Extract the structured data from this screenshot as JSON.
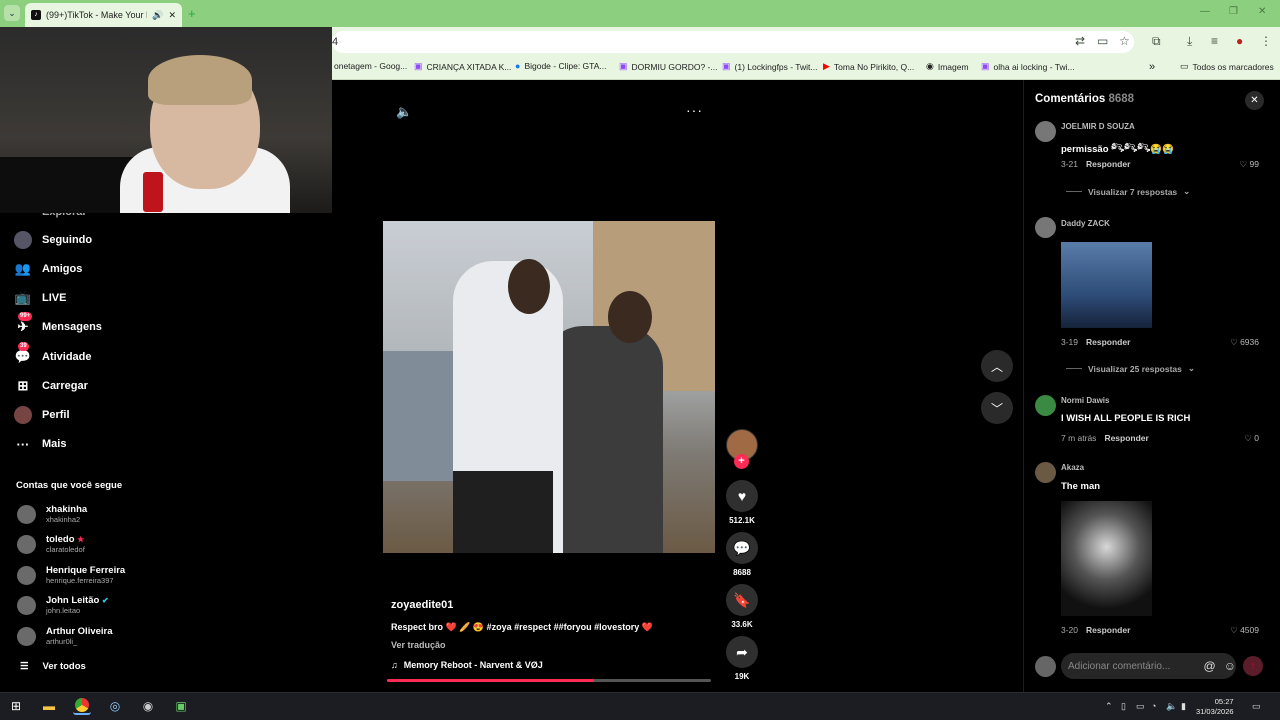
{
  "browser": {
    "tab_title": "(99+)TikTok - Make Your Da",
    "tab_dropdown_icon": "chevron-down-icon",
    "tab_favicon": "tiktok-icon",
    "tab_audio_icon": "speaker-icon",
    "tab_close_icon": "close-icon",
    "new_tab_icon": "plus-icon",
    "address_fragment": "4",
    "bookmarks": [
      {
        "label": "onetagem - Goog...",
        "icon": "twitch-icon"
      },
      {
        "label": "CRIANÇA XITADA K...",
        "icon": "twitch-icon"
      },
      {
        "label": "Bigode - Clipe: GTA...",
        "icon": "facebook-icon"
      },
      {
        "label": "DORMIU GORDO? -...",
        "icon": "twitch-icon"
      },
      {
        "label": "(1) Lockingfps - Twit...",
        "icon": "twitch-icon"
      },
      {
        "label": "Toma No Pirikito, Q...",
        "icon": "youtube-icon"
      },
      {
        "label": "Imagem",
        "icon": "github-icon"
      },
      {
        "label": "olha ai locking - Twi...",
        "icon": "twitch-icon"
      }
    ],
    "bookmarks_overflow": "»",
    "all_bookmarks": "Todos os marcadores"
  },
  "sidebar": {
    "partial_item": "Explorar",
    "items": [
      {
        "label": "Seguindo",
        "icon": "following-icon",
        "badge": ""
      },
      {
        "label": "Amigos",
        "icon": "friends-icon",
        "badge": ""
      },
      {
        "label": "LIVE",
        "icon": "live-icon",
        "badge": ""
      },
      {
        "label": "Mensagens",
        "icon": "messages-icon",
        "badge": "99+"
      },
      {
        "label": "Atividade",
        "icon": "activity-icon",
        "badge": "39"
      },
      {
        "label": "Carregar",
        "icon": "upload-icon",
        "badge": ""
      },
      {
        "label": "Perfil",
        "icon": "profile-icon",
        "badge": ""
      },
      {
        "label": "Mais",
        "icon": "more-icon",
        "badge": ""
      }
    ],
    "following_title": "Contas que você segue",
    "following": [
      {
        "name": "xhakinha",
        "handle": "xhakinha2"
      },
      {
        "name": "toledo",
        "handle": "claratoledof"
      },
      {
        "name": "Henrique Ferreira",
        "handle": "henrique.ferreira397"
      },
      {
        "name": "John Leitão",
        "handle": "john.leitao"
      },
      {
        "name": "Arthur Oliveira",
        "handle": "arthur0li_"
      }
    ],
    "see_all": "Ver todos"
  },
  "video": {
    "author": "zoyaedite01",
    "caption": "Respect bro ❤️ 🥖 😍 #zoya #respect ##foryou #lovestory ❤️",
    "translate": "Ver tradução",
    "music": "Memory Reboot - Narvent & VØJ",
    "progress": 0.64,
    "likes": "512.1K",
    "comments": "8688",
    "saves": "33.6K",
    "shares": "19K"
  },
  "comments": {
    "title": "Comentários",
    "count": "8688",
    "items": [
      {
        "user": "JOELMIR D SOUZA",
        "text": "permissão 𓀐𓀐𓀐😭😭",
        "time": "3-21",
        "reply": "Responder",
        "likes": "99",
        "replies": "Visualizar 7 respostas"
      },
      {
        "user": "Daddy ZACK",
        "text": "",
        "time": "3-19",
        "reply": "Responder",
        "likes": "6936",
        "replies": "Visualizar 25 respostas"
      },
      {
        "user": "Normi Dawis",
        "text": "I WISH ALL PEOPLE IS RICH",
        "time": "7 m atrás",
        "reply": "Responder",
        "likes": "0",
        "replies": ""
      },
      {
        "user": "Akaza",
        "text": "The man",
        "time": "3-20",
        "reply": "Responder",
        "likes": "4509",
        "replies": ""
      }
    ],
    "input_placeholder": "Adicionar comentário...",
    "mention_symbol": "@"
  },
  "taskbar": {
    "time": "05:27",
    "date": "31/03/2026",
    "apps": [
      "windows-icon",
      "file-explorer-icon",
      "chrome-icon",
      "steam-icon",
      "obs-icon",
      "terminal-icon"
    ]
  },
  "colors": {
    "accent": "#fe2c55",
    "chrome_green": "#8ccf7e"
  }
}
